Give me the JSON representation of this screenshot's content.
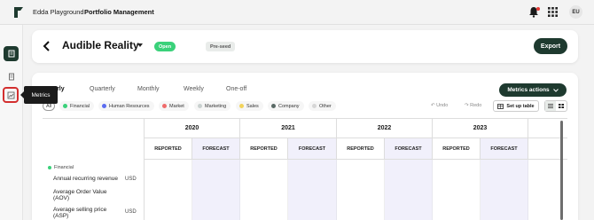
{
  "topbar": {
    "app_title": "Edda Playground",
    "section": "Portfolio Management",
    "avatar_initials": "EU",
    "icons": [
      "logo-icon",
      "bell-icon",
      "apps-grid-icon"
    ]
  },
  "sidebar": {
    "items": [
      "portfolio-icon",
      "document-icon",
      "metrics-icon"
    ],
    "tooltip": "Metrics"
  },
  "header": {
    "company": "Audible Reality",
    "status": "Open",
    "stage": "Pre-seed",
    "export_label": "Export"
  },
  "periods": [
    "Yearly",
    "Quarterly",
    "Monthly",
    "Weekly",
    "One-off"
  ],
  "metrics_actions_label": "Metrics actions",
  "filters": {
    "all_label": "All",
    "chips": [
      {
        "label": "Financial",
        "color": "#3ad17a"
      },
      {
        "label": "Human Resources",
        "color": "#5b6cf0"
      },
      {
        "label": "Market",
        "color": "#ef6b6b"
      },
      {
        "label": "Marketing",
        "color": "#c9d0cf"
      },
      {
        "label": "Sales",
        "color": "#f2d35b"
      },
      {
        "label": "Company",
        "color": "#5a6a66"
      },
      {
        "label": "Other",
        "color": "#d6d6d6"
      }
    ]
  },
  "toolbar": {
    "undo": "Undo",
    "redo": "Redo",
    "setup_table": "Set up table"
  },
  "table": {
    "years": [
      "2020",
      "2021",
      "2022",
      "2023"
    ],
    "subheaders": [
      "REPORTED",
      "FORECAST"
    ],
    "section": "Financial",
    "rows": [
      {
        "label": "Annual recurring revenue",
        "unit": "USD"
      },
      {
        "label": "Average Order Value (AOV)",
        "unit": ""
      },
      {
        "label": "Average selling price (ASP)",
        "unit": "USD"
      }
    ]
  },
  "colors": {
    "primary": "#1e3a2f",
    "open_badge": "#3ad17a",
    "forecast_bg": "#f1f0fb",
    "highlight": "#d32f2f"
  }
}
